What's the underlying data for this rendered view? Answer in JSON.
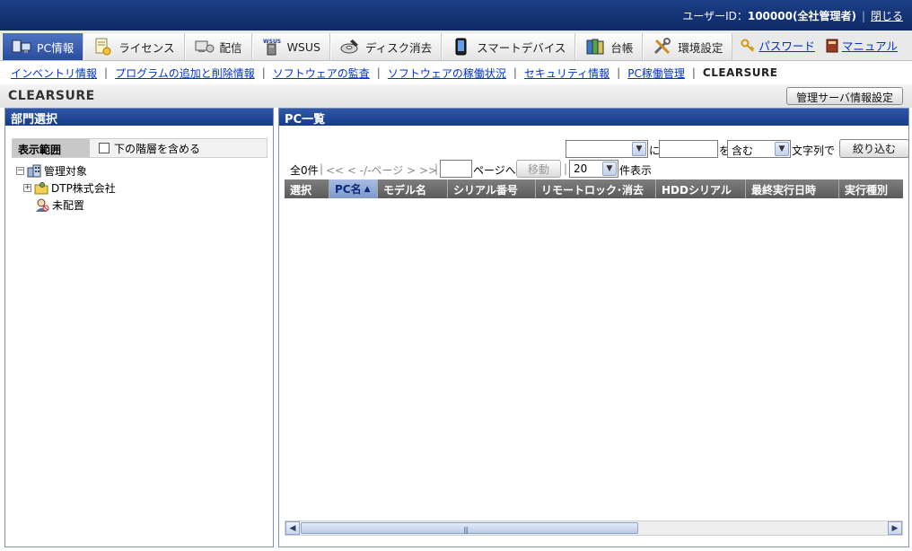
{
  "header": {
    "user_label": "ユーザーID：",
    "user_id": "100000(全社管理者)",
    "close_link": "閉じる"
  },
  "tabs": [
    {
      "label": "PC情報",
      "icon": "pc-info-icon",
      "active": true
    },
    {
      "label": "ライセンス",
      "icon": "license-icon",
      "active": false
    },
    {
      "label": "配信",
      "icon": "delivery-icon",
      "active": false
    },
    {
      "label": "WSUS",
      "icon": "wsus-icon",
      "active": false
    },
    {
      "label": "ディスク消去",
      "icon": "disk-erase-icon",
      "active": false
    },
    {
      "label": "スマートデバイス",
      "icon": "smart-device-icon",
      "active": false
    },
    {
      "label": "台帳",
      "icon": "ledger-icon",
      "active": false
    },
    {
      "label": "環境設定",
      "icon": "settings-tools-icon",
      "active": false
    }
  ],
  "header_links": {
    "password": "パスワード",
    "manual": "マニュアル"
  },
  "subnav": {
    "items": [
      "インベントリ情報",
      "プログラムの追加と削除情報",
      "ソフトウェアの監査",
      "ソフトウェアの稼働状況",
      "セキュリティ情報",
      "PC稼働管理"
    ],
    "current": "CLEARSURE"
  },
  "page": {
    "title": "CLEARSURE",
    "server_info_button": "管理サーバ情報設定"
  },
  "left_panel": {
    "title": "部門選択",
    "scope_label": "表示範囲",
    "include_sublevels": "下の階層を含める",
    "tree": {
      "root": "管理対象",
      "company": "DTP株式会社",
      "unassigned": "未配置"
    }
  },
  "right_panel": {
    "title": "PC一覧",
    "filter": {
      "field_value": "",
      "ni": "に",
      "text_value": "",
      "wo": "を",
      "match_mode": "含む",
      "suffix": "文字列で",
      "button": "絞り込む"
    },
    "pager": {
      "total": "全0件",
      "nav": "<< < -/-ページ > >>",
      "page_input": "",
      "goto_label": "ページへ",
      "move_button": "移動",
      "per_page": "20",
      "per_page_suffix": "件表示"
    },
    "columns": [
      "選択",
      "PC名",
      "モデル名",
      "シリアル番号",
      "リモートロック･消去",
      "HDDシリアル",
      "最終実行日時",
      "実行種別"
    ],
    "sorted_column": "PC名"
  }
}
